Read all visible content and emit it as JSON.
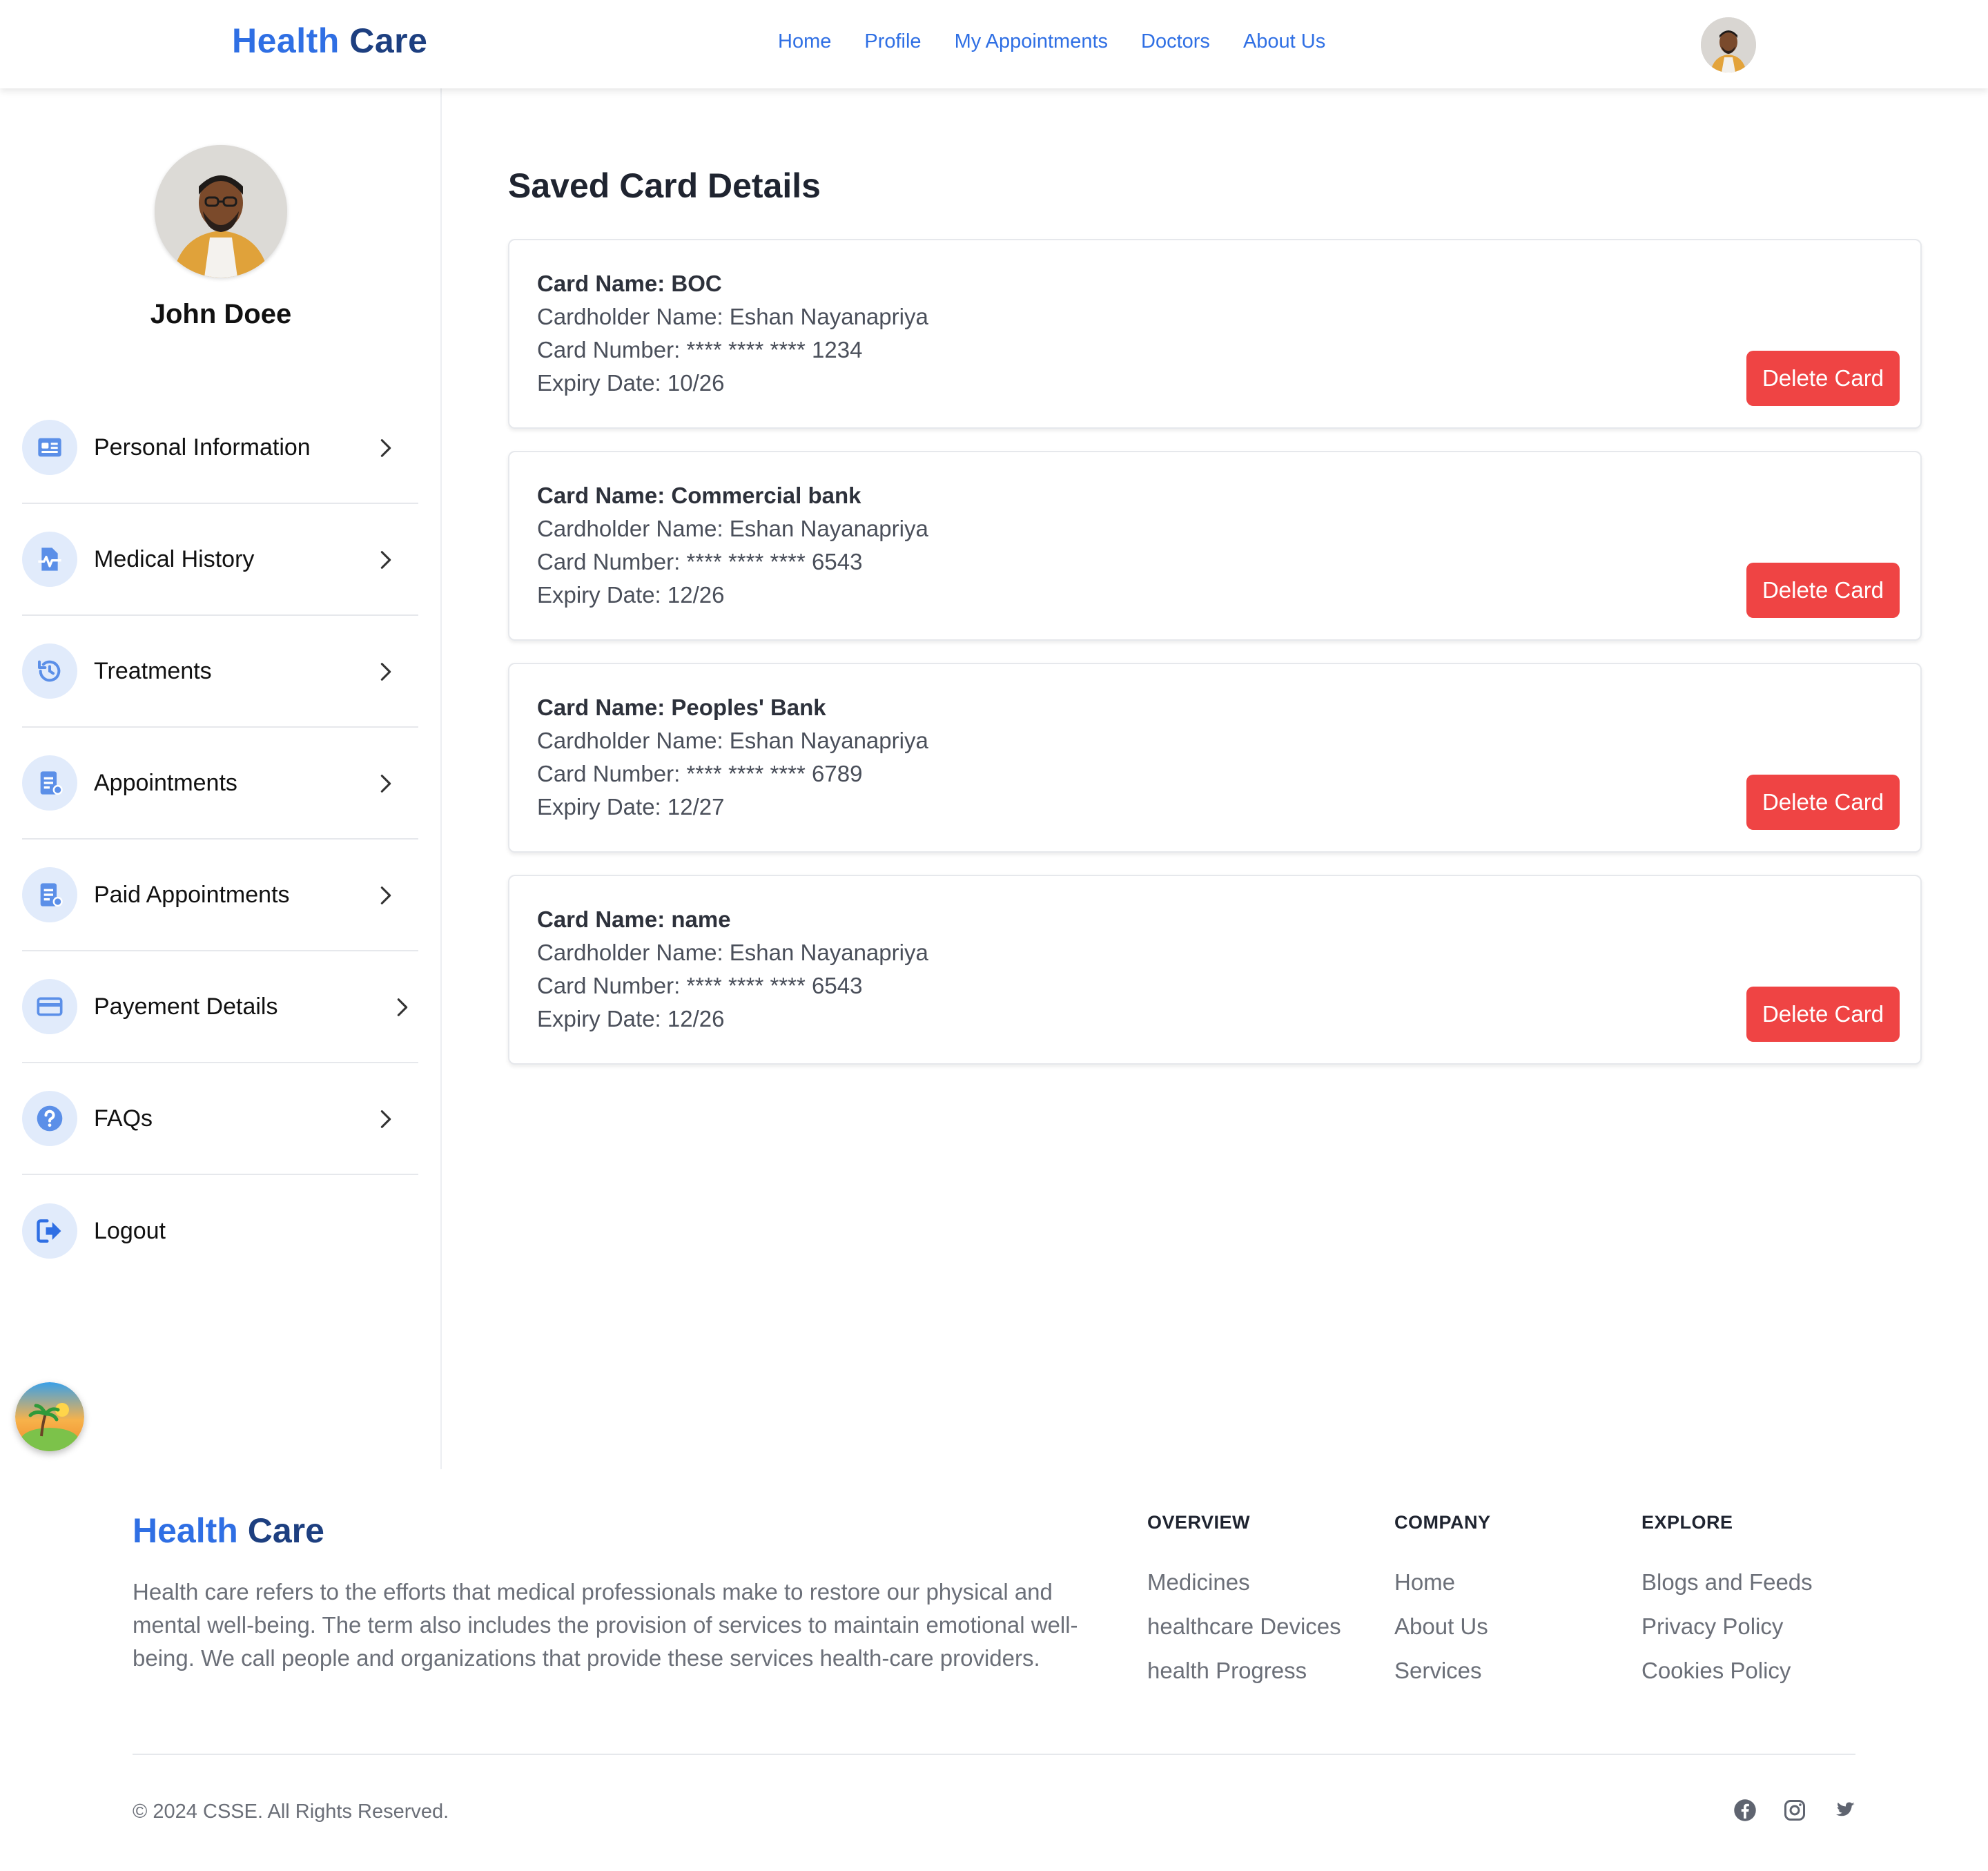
{
  "header": {
    "brand_part1": "Health",
    "brand_part2": "Care",
    "nav": [
      "Home",
      "Profile",
      "My Appointments",
      "Doctors",
      "About Us"
    ]
  },
  "sidebar": {
    "user_name": "John Doee",
    "items": [
      {
        "label": "Personal Information",
        "icon": "id-card-icon"
      },
      {
        "label": "Medical History",
        "icon": "medical-file-icon"
      },
      {
        "label": "Treatments",
        "icon": "history-clock-icon"
      },
      {
        "label": "Appointments",
        "icon": "appointment-doc-icon"
      },
      {
        "label": "Paid Appointments",
        "icon": "paid-doc-icon"
      },
      {
        "label": "Payement Details",
        "icon": "credit-card-icon"
      },
      {
        "label": "FAQs",
        "icon": "question-icon"
      },
      {
        "label": "Logout",
        "icon": "logout-icon"
      }
    ]
  },
  "main": {
    "title": "Saved Card Details",
    "delete_label": "Delete Card",
    "cards": [
      {
        "name": "Card Name: BOC",
        "holder": "Cardholder Name: Eshan Nayanapriya",
        "number": "Card Number: **** **** **** 1234",
        "expiry": "Expiry Date: 10/26"
      },
      {
        "name": "Card Name: Commercial bank",
        "holder": "Cardholder Name: Eshan Nayanapriya",
        "number": "Card Number: **** **** **** 6543",
        "expiry": "Expiry Date: 12/26"
      },
      {
        "name": "Card Name: Peoples' Bank",
        "holder": "Cardholder Name: Eshan Nayanapriya",
        "number": "Card Number: **** **** **** 6789",
        "expiry": "Expiry Date: 12/27"
      },
      {
        "name": "Card Name: name",
        "holder": "Cardholder Name: Eshan Nayanapriya",
        "number": "Card Number: **** **** **** 6543",
        "expiry": "Expiry Date: 12/26"
      }
    ]
  },
  "footer": {
    "brand_part1": "Health",
    "brand_part2": "Care",
    "description": "Health care refers to the efforts that medical professionals make to restore our physical and mental well-being. The term also includes the provision of services to maintain emotional well-being. We call people and organizations that provide these services health-care providers.",
    "columns": [
      {
        "heading": "OVERVIEW",
        "links": [
          "Medicines",
          "healthcare Devices",
          "health Progress"
        ]
      },
      {
        "heading": "COMPANY",
        "links": [
          "Home",
          "About Us",
          "Services"
        ]
      },
      {
        "heading": "EXPLORE",
        "links": [
          "Blogs and Feeds",
          "Privacy Policy",
          "Cookies Policy"
        ]
      }
    ],
    "copyright": "© 2024 CSSE. All Rights Reserved.",
    "social": [
      "facebook-icon",
      "instagram-icon",
      "twitter-icon"
    ]
  },
  "colors": {
    "accent": "#2f6fe4",
    "brand_dark": "#1d3f80",
    "danger": "#ef4444",
    "icon_bg": "#e1ebfb"
  }
}
